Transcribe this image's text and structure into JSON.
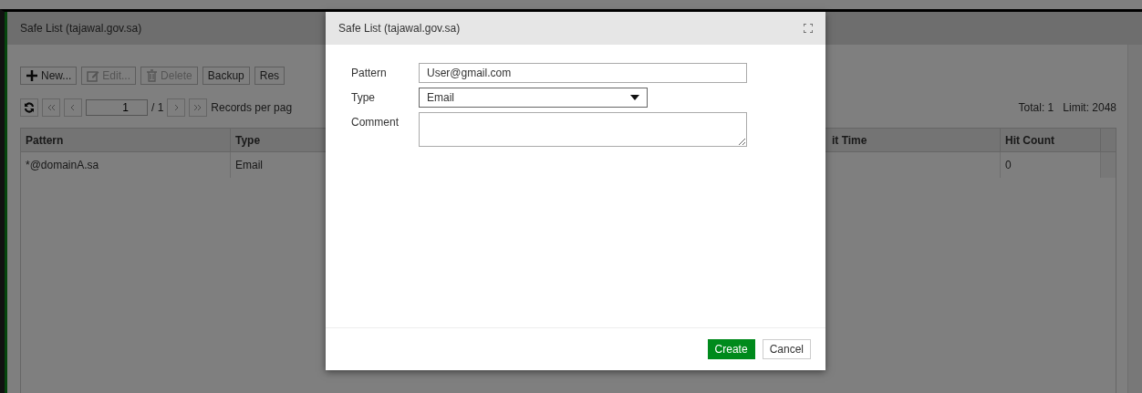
{
  "page": {
    "title": "Safe List (tajawal.gov.sa)",
    "toolbar": [
      {
        "label": "New...",
        "disabled": false
      },
      {
        "label": "Edit...",
        "disabled": true
      },
      {
        "label": "Delete",
        "disabled": true
      },
      {
        "label": "Backup",
        "disabled": false
      },
      {
        "label": "Res",
        "disabled": false
      }
    ],
    "pagination": {
      "page": "1",
      "of": "/ 1",
      "records_label": "Records per pag"
    },
    "totals": {
      "total": "Total: 1",
      "limit": "Limit: 2048"
    },
    "table": {
      "columns": [
        "Pattern",
        "Type",
        "it Time",
        "Hit Count"
      ],
      "rows": [
        [
          "*@domainA.sa",
          "Email",
          "",
          "0"
        ]
      ]
    }
  },
  "dialog": {
    "title": "Safe List (tajawal.gov.sa)",
    "fields": [
      {
        "kind": "text",
        "label": "Pattern",
        "value": "User@gmail.com"
      },
      {
        "kind": "select",
        "label": "Type",
        "value": "Email"
      },
      {
        "kind": "textarea",
        "label": "Comment"
      }
    ],
    "buttons": [
      {
        "label": "Create",
        "primary": true
      },
      {
        "label": "Cancel",
        "primary": false
      }
    ]
  }
}
